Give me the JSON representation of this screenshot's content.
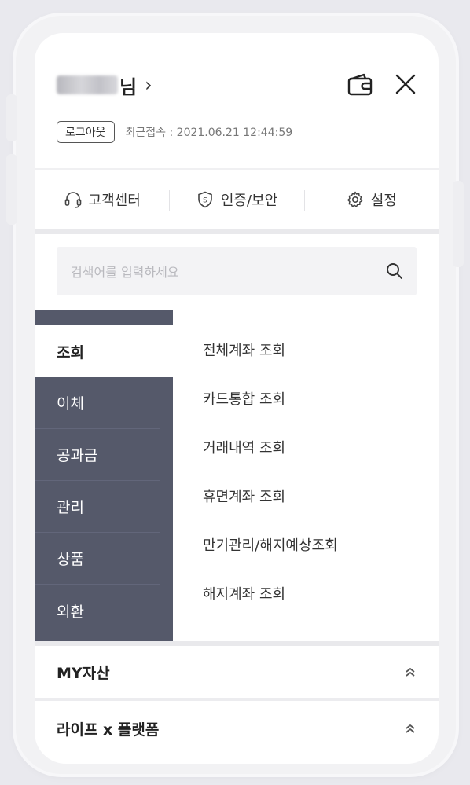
{
  "header": {
    "user_suffix": "님",
    "chevron": "›",
    "wallet_icon": "wallet-icon",
    "close_icon": "close-icon",
    "logout_label": "로그아웃",
    "last_login": "최근접속 : 2021.06.21 12:44:59"
  },
  "quick_menu": [
    {
      "icon": "headset-icon",
      "label": "고객센터"
    },
    {
      "icon": "shield-icon",
      "label": "인증/보안"
    },
    {
      "icon": "gear-icon",
      "label": "설정"
    }
  ],
  "search": {
    "placeholder": "검색어를 입력하세요"
  },
  "menu": {
    "categories": [
      "조회",
      "이체",
      "공과금",
      "관리",
      "상품",
      "외환"
    ],
    "selected": "조회",
    "sub_items": [
      "전체계좌 조회",
      "카드통합 조회",
      "거래내역 조회",
      "휴면계좌 조회",
      "만기관리/해지예상조회",
      "해지계좌 조회"
    ]
  },
  "sections": [
    {
      "label": "MY자산"
    },
    {
      "label": "라이프 x 플랫폼"
    }
  ],
  "colors": {
    "menu_dark": "#55596a",
    "divider": "#e9e9ec"
  }
}
